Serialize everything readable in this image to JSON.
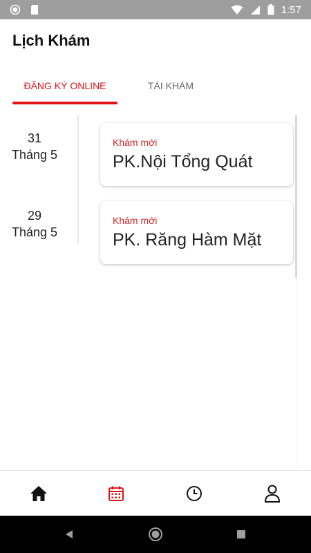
{
  "status_bar": {
    "time": "1:57",
    "icons": [
      "circle-notification-icon",
      "sd-card-icon",
      "wifi-icon",
      "signal-icon",
      "battery-icon"
    ]
  },
  "header": {
    "title": "Lịch Khám"
  },
  "tabs": [
    {
      "label": "ĐĂNG KÝ ONLINE",
      "active": true
    },
    {
      "label": "TÁI KHÁM",
      "active": false
    }
  ],
  "appointments": [
    {
      "day": "31",
      "month": "Tháng 5",
      "type": "Khám mới",
      "clinic": "PK.Nội Tổng Quát"
    },
    {
      "day": "29",
      "month": "Tháng 5",
      "type": "Khám mới",
      "clinic": "PK. Răng Hàm Mặt"
    }
  ],
  "bottom_nav": {
    "items": [
      {
        "icon": "home-icon",
        "active": false
      },
      {
        "icon": "calendar-icon",
        "active": true
      },
      {
        "icon": "clock-icon",
        "active": false
      },
      {
        "icon": "user-icon",
        "active": false
      }
    ]
  },
  "colors": {
    "accent": "#e0131a",
    "status_bar": "#9e9e9e",
    "text_primary": "#222222",
    "tab_inactive": "#666666"
  }
}
